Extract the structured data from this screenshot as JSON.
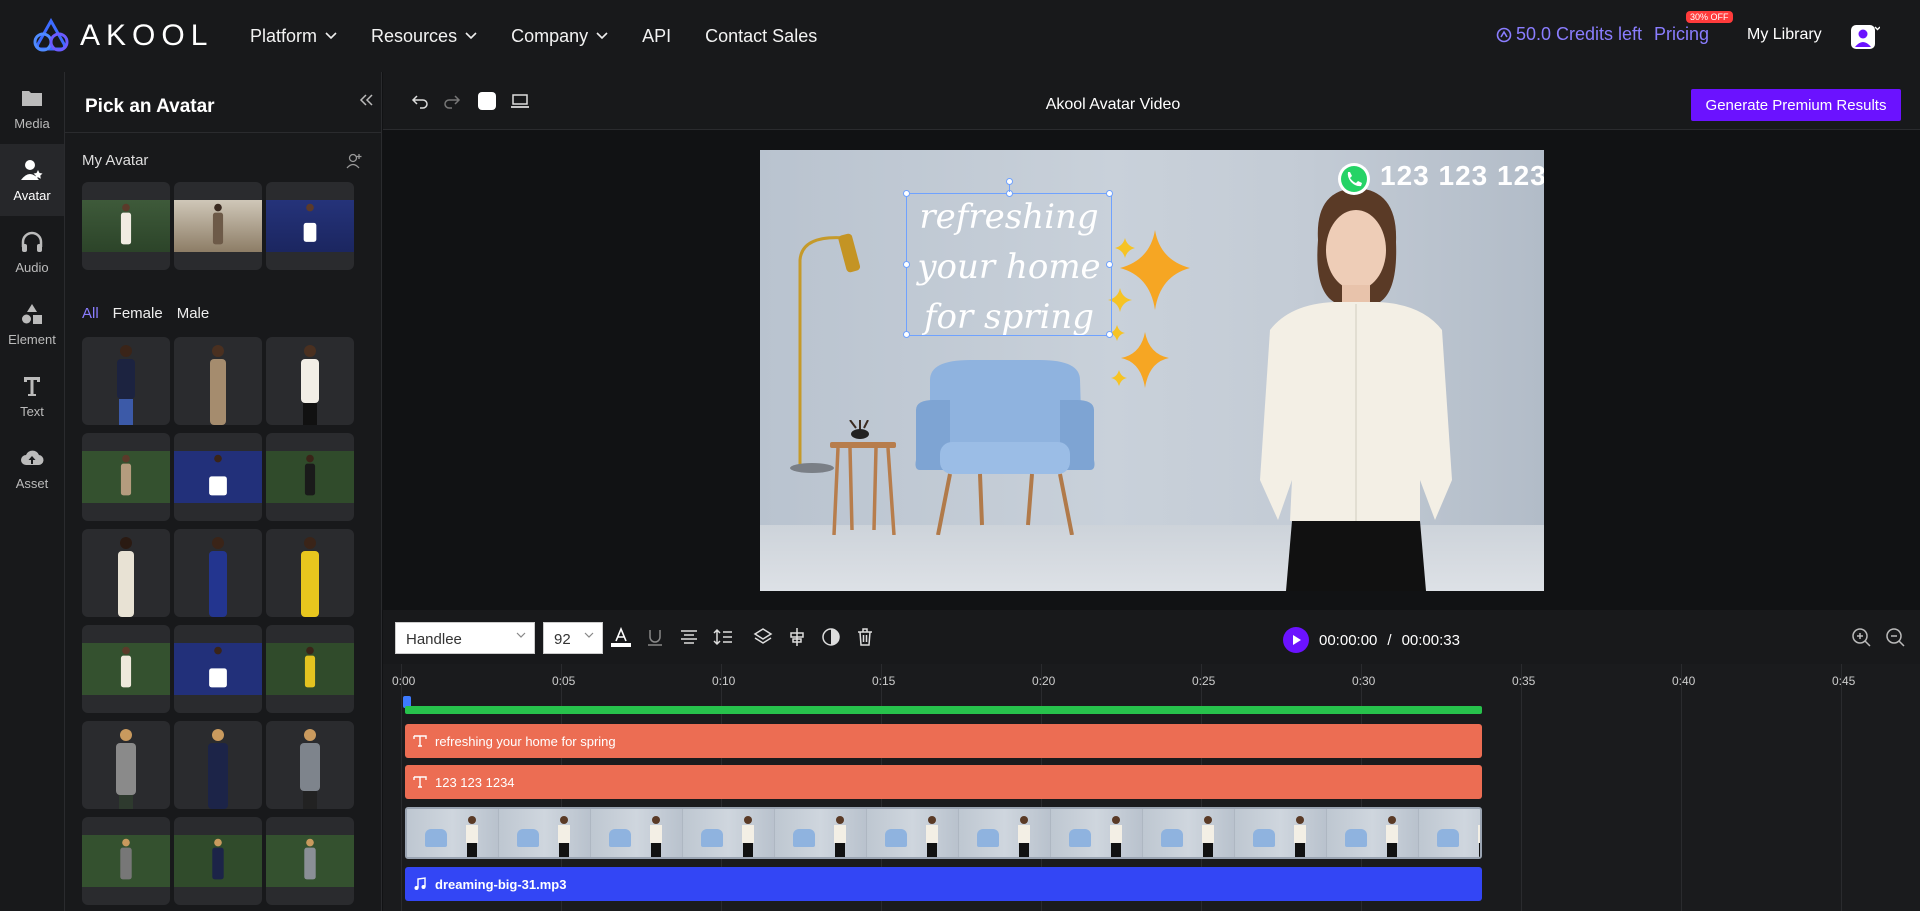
{
  "nav": {
    "brand": "AKOOL",
    "items": [
      {
        "label": "Platform",
        "dropdown": true
      },
      {
        "label": "Resources",
        "dropdown": true
      },
      {
        "label": "Company",
        "dropdown": true
      },
      {
        "label": "API",
        "dropdown": false
      },
      {
        "label": "Contact Sales",
        "dropdown": false
      }
    ],
    "credits": "50.0 Credits left",
    "pricing": "Pricing",
    "pricing_badge": "30% OFF",
    "my_library": "My Library"
  },
  "sidebar": {
    "items": [
      {
        "label": "Media",
        "icon": "folder-icon"
      },
      {
        "label": "Avatar",
        "icon": "avatar-icon",
        "active": true
      },
      {
        "label": "Audio",
        "icon": "headphones-icon"
      },
      {
        "label": "Element",
        "icon": "shapes-icon"
      },
      {
        "label": "Text",
        "icon": "text-icon"
      },
      {
        "label": "Asset",
        "icon": "cloud-upload-icon"
      }
    ]
  },
  "panel": {
    "title": "Pick an Avatar",
    "my_avatar_label": "My Avatar",
    "filters": [
      {
        "label": "All",
        "active": true
      },
      {
        "label": "Female",
        "active": false
      },
      {
        "label": "Male",
        "active": false
      }
    ]
  },
  "toolbar": {
    "title": "Akool Avatar Video",
    "generate_label": "Generate Premium Results"
  },
  "canvas": {
    "headline": "refreshing your home for spring",
    "phone": "123 123 1234"
  },
  "editor": {
    "font": "Handlee",
    "size": "92",
    "current_time": "00:00:00",
    "separator": "/",
    "total_time": "00:00:33"
  },
  "timeline": {
    "ticks": [
      "0:00",
      "0:05",
      "0:10",
      "0:15",
      "0:20",
      "0:25",
      "0:30",
      "0:35",
      "0:40",
      "0:45"
    ],
    "tracks": {
      "text1": "refreshing your home for spring",
      "text2": "123 123 1234",
      "audio": "dreaming-big-31.mp3"
    }
  },
  "colors": {
    "accent": "#6b12ff",
    "credits": "#8a7dff",
    "text_track": "#ec6d53",
    "audio_track": "#3346f5",
    "progress_track": "#27c24c"
  }
}
